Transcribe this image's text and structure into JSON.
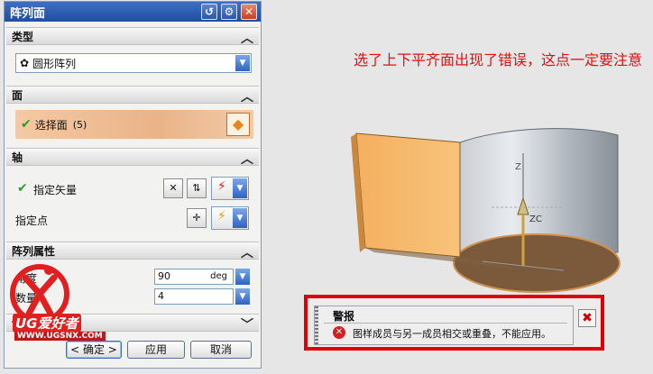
{
  "dialog": {
    "title": "阵列面",
    "sections": {
      "type": "类型",
      "face": "面",
      "axis": "轴",
      "props": "阵列属性",
      "settings": "设置"
    },
    "type_value": "圆形阵列",
    "select_face_label": "选择面",
    "select_face_count": "(5)",
    "vector_label": "指定矢量",
    "point_label": "指定点",
    "angle_label": "角度",
    "angle_value": "90",
    "angle_unit": "deg",
    "count_label": "数量",
    "count_value": "4",
    "ok_label": "< 确定 >",
    "apply_label": "应用",
    "cancel_label": "取消"
  },
  "logo": {
    "brand": "UG爱好者",
    "url": "WWW.UGSNX.COM"
  },
  "annotation": "选了上下平齐面出现了错误，这点一定要注意",
  "scene": {
    "zc_label": "ZC",
    "axis_top_label": "Z"
  },
  "alert": {
    "title": "警报",
    "message": "图样成员与另一成员相交或重叠，不能应用。"
  },
  "colors": {
    "accent": "#1f4ea3",
    "selection": "#eab388",
    "error": "#e00000"
  }
}
